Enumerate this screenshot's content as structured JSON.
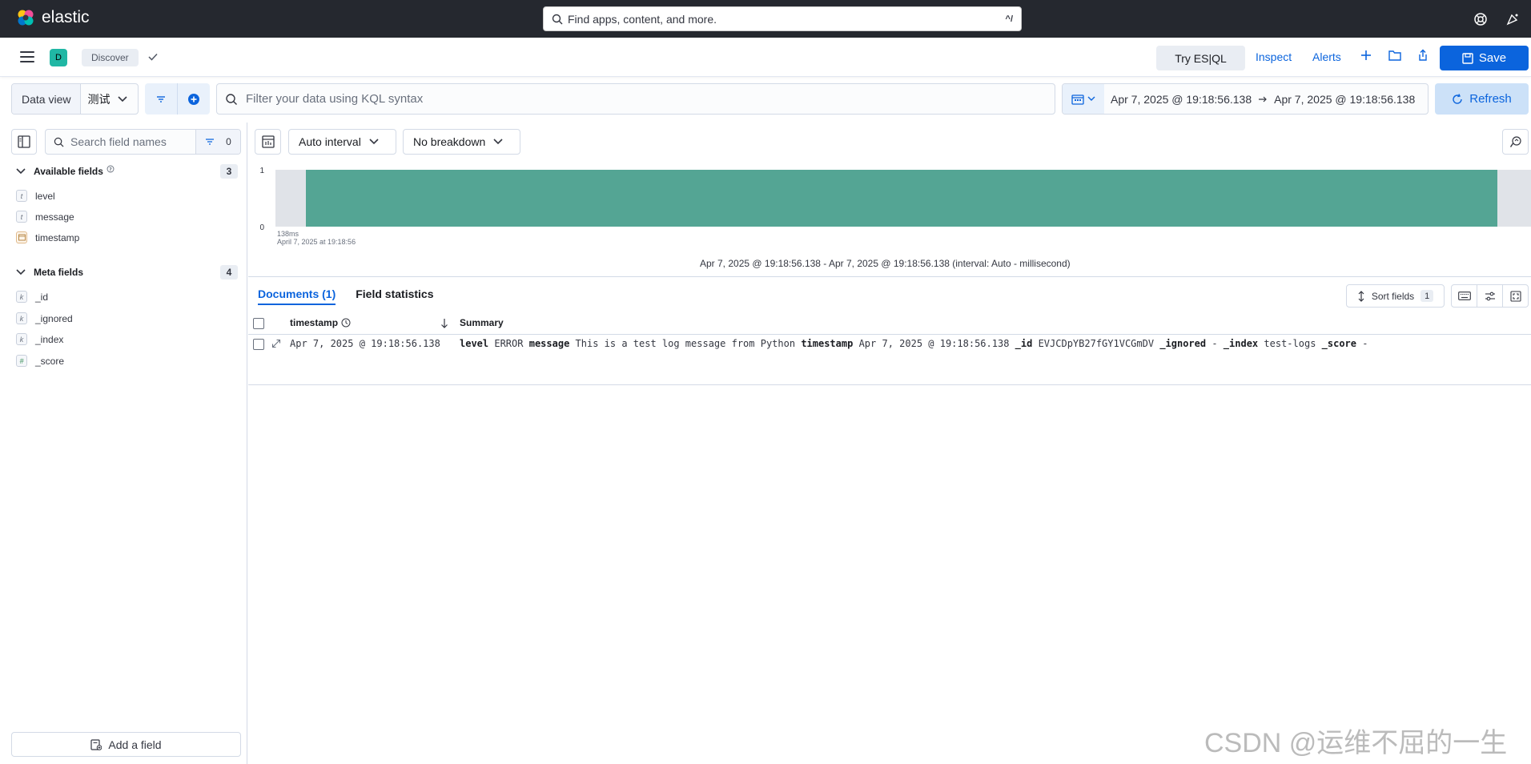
{
  "header": {
    "brand": "elastic",
    "search_placeholder": "Find apps, content, and more.",
    "search_shortcut": "^/"
  },
  "appbar": {
    "space_initial": "D",
    "breadcrumb": "Discover",
    "try_esql": "Try ES|QL",
    "inspect": "Inspect",
    "alerts": "Alerts",
    "save": "Save"
  },
  "querybar": {
    "data_view_label": "Data view",
    "data_view_value": "测试",
    "kql_placeholder": "Filter your data using KQL syntax",
    "date_start": "Apr 7, 2025 @ 19:18:56.138",
    "date_end": "Apr 7, 2025 @ 19:18:56.138",
    "refresh": "Refresh"
  },
  "sidebar": {
    "search_placeholder": "Search field names",
    "filter_count": "0",
    "available_label": "Available fields",
    "available_count": "3",
    "available_fields": [
      {
        "type": "t",
        "name": "level"
      },
      {
        "type": "t",
        "name": "message"
      },
      {
        "type": "date",
        "name": "timestamp"
      }
    ],
    "meta_label": "Meta fields",
    "meta_count": "4",
    "meta_fields": [
      {
        "type": "k",
        "name": "_id"
      },
      {
        "type": "k",
        "name": "_ignored"
      },
      {
        "type": "k",
        "name": "_index"
      },
      {
        "type": "#",
        "name": "_score"
      }
    ],
    "add_field": "Add a field"
  },
  "histogram": {
    "interval_label": "Auto interval",
    "breakdown_label": "No breakdown",
    "y_ticks": [
      "1",
      "0"
    ],
    "x_tick_line1": "138ms",
    "x_tick_line2": "April 7, 2025 at 19:18:56",
    "bar_color": "#54a594",
    "caption": "Apr 7, 2025 @ 19:18:56.138 - Apr 7, 2025 @ 19:18:56.138 (interval: Auto - millisecond)"
  },
  "chart_data": {
    "type": "bar",
    "categories": [
      "138ms"
    ],
    "values": [
      1
    ],
    "ylim": [
      0,
      1
    ]
  },
  "results": {
    "tab_documents": "Documents (1)",
    "tab_field_stats": "Field statistics",
    "sort_fields": "Sort fields",
    "sort_count": "1",
    "col_timestamp": "timestamp",
    "col_summary": "Summary",
    "rows": [
      {
        "timestamp": "Apr 7, 2025 @ 19:18:56.138",
        "summary": [
          {
            "key": "level",
            "value": "ERROR"
          },
          {
            "key": "message",
            "value": "This is a test log message from Python"
          },
          {
            "key": "timestamp",
            "value": "Apr 7, 2025 @ 19:18:56.138"
          },
          {
            "key": "_id",
            "value": "EVJCDpYB27fGY1VCGmDV"
          },
          {
            "key": "_ignored",
            "value": " - "
          },
          {
            "key": "_index",
            "value": "test-logs"
          },
          {
            "key": "_score",
            "value": " - "
          }
        ]
      }
    ]
  },
  "watermark": "CSDN @运维不屈的一生"
}
